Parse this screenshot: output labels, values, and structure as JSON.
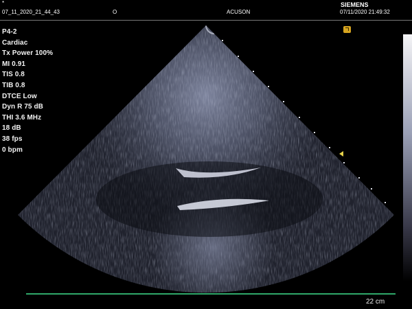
{
  "header": {
    "file_name": "07_11_2020_21_44_43",
    "mark": "O",
    "system": "ACUSON",
    "brand": "SIEMENS",
    "datetime": "07/11/2020 21:49:32",
    "corner_mark": "*"
  },
  "params": [
    "P4-2",
    "Cardiac",
    "Tx Power 100%",
    "MI 0.91",
    "TIS 0.8",
    "TIB 0.8",
    "DTCE Low",
    "Dyn R 75 dB",
    "THI 3.6 MHz",
    "18 dB",
    "38 fps",
    "0 bpm"
  ],
  "depth_label": "22 cm",
  "icons": {
    "frame": "frame-corner-icon",
    "focus": "focus-marker-icon"
  },
  "colors": {
    "background": "#000000",
    "baseline": "#2fa86a",
    "focus_marker": "#e6d24a",
    "frame_icon": "#d7a520"
  }
}
